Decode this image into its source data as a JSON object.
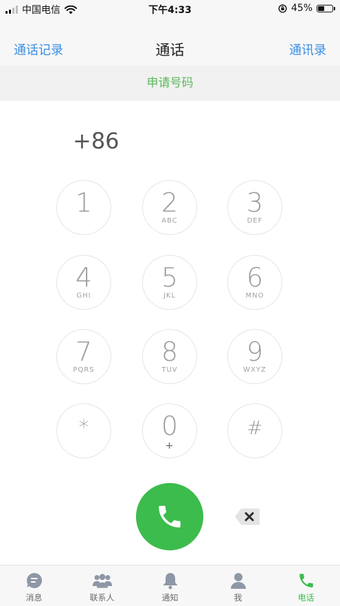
{
  "status_bar": {
    "carrier": "中国电信",
    "time": "下午4:33",
    "battery": "45%",
    "battery_level": 0.45
  },
  "nav": {
    "left": "通话记录",
    "title": "通话",
    "right": "通讯录"
  },
  "apply_number": "申请号码",
  "dial": {
    "number": "+86"
  },
  "keypad": {
    "keys": [
      {
        "digit": "1",
        "letters": ""
      },
      {
        "digit": "2",
        "letters": "ABC"
      },
      {
        "digit": "3",
        "letters": "DEF"
      },
      {
        "digit": "4",
        "letters": "GHI"
      },
      {
        "digit": "5",
        "letters": "JKL"
      },
      {
        "digit": "6",
        "letters": "MNO"
      },
      {
        "digit": "7",
        "letters": "PQRS"
      },
      {
        "digit": "8",
        "letters": "TUV"
      },
      {
        "digit": "9",
        "letters": "WXYZ"
      },
      {
        "digit": "*",
        "letters": ""
      },
      {
        "digit": "0",
        "letters": "+"
      },
      {
        "digit": "#",
        "letters": ""
      }
    ]
  },
  "tabs": [
    {
      "label": "消息",
      "icon": "message-icon"
    },
    {
      "label": "联系人",
      "icon": "contacts-icon"
    },
    {
      "label": "通知",
      "icon": "bell-icon"
    },
    {
      "label": "我",
      "icon": "person-icon"
    },
    {
      "label": "电话",
      "icon": "phone-icon",
      "active": true
    }
  ],
  "colors": {
    "accent_green": "#3cbc4c",
    "link_blue": "#3a8ee6",
    "tab_icon_grey": "#8e97a6"
  }
}
